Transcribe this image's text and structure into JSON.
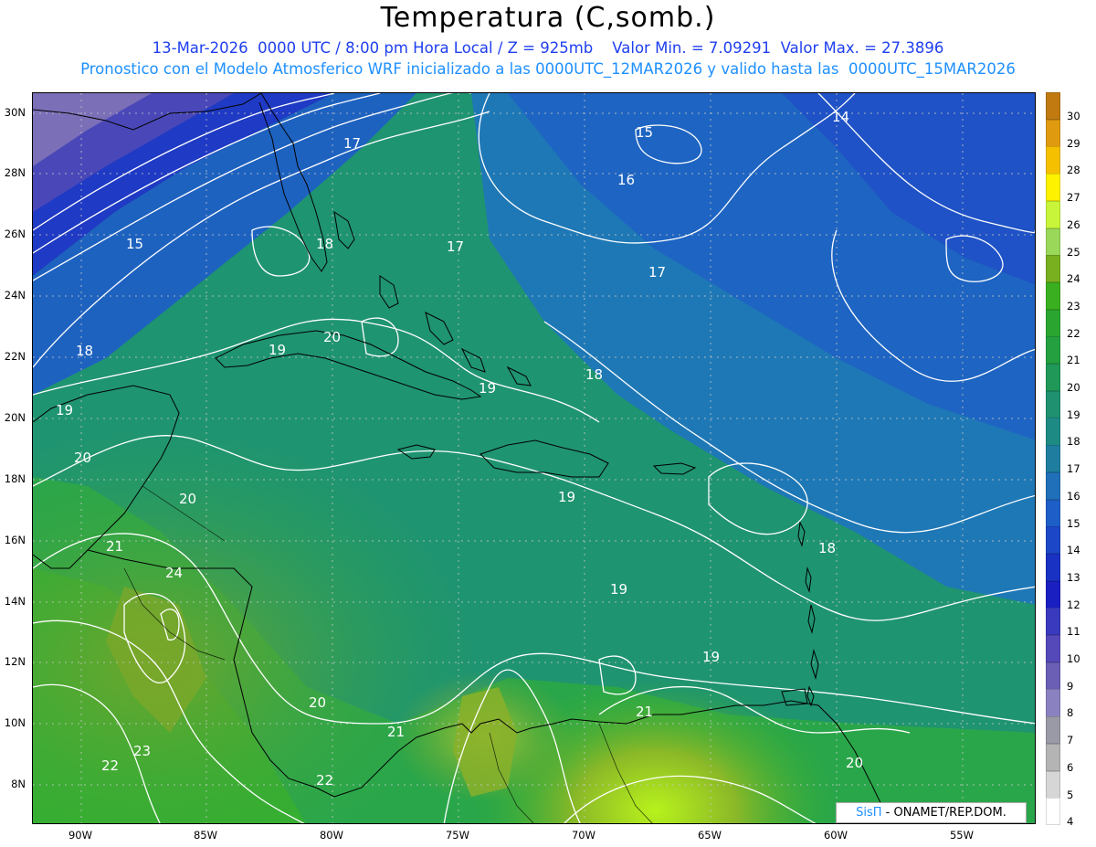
{
  "header": {
    "title": "Temperatura (C,somb.)",
    "subtitle_line1": "13-Mar-2026  0000 UTC / 8:00 pm Hora Local / Z = 925mb    Valor Min. = 7.09291  Valor Max. = 27.3896",
    "subtitle_line2": "Pronostico con el Modelo Atmosferico WRF inicializado a las 0000UTC_12MAR2026 y valido hasta las  0000UTC_15MAR2026"
  },
  "map": {
    "lat_labels": [
      "30N",
      "28N",
      "26N",
      "24N",
      "22N",
      "20N",
      "18N",
      "16N",
      "14N",
      "12N",
      "10N",
      "8N"
    ],
    "lon_labels": [
      "90W",
      "85W",
      "80W",
      "75W",
      "70W",
      "65W",
      "60W",
      "55W"
    ],
    "contour_labels": [
      "14",
      "15",
      "15",
      "16",
      "17",
      "17",
      "17",
      "18",
      "18",
      "18",
      "18",
      "19",
      "19",
      "19",
      "19",
      "19",
      "19",
      "20",
      "20",
      "20",
      "20",
      "20",
      "21",
      "21",
      "21",
      "22",
      "22",
      "23",
      "24"
    ],
    "colors": {
      "violet": "#7b6fb8",
      "deep_blue": "#1f2fc0",
      "blue": "#1e5ac8",
      "mid_blue": "#1f6fbb",
      "teal": "#1d8a8a",
      "teal_green": "#1f9470",
      "green": "#2aa64a",
      "bright_green": "#34b02c",
      "olive": "#7aa82a",
      "yellow_green": "#b8f21c",
      "land_outline": "#000000",
      "contour": "#ffffff"
    }
  },
  "colorbar": {
    "labels": [
      "30",
      "29",
      "28",
      "27",
      "26",
      "25",
      "24",
      "23",
      "22",
      "21",
      "20",
      "19",
      "18",
      "17",
      "16",
      "15",
      "14",
      "13",
      "12",
      "11",
      "10",
      "9",
      "8",
      "7",
      "6",
      "5",
      "4"
    ],
    "colors": [
      "#c07a10",
      "#e09a10",
      "#f5c000",
      "#fff200",
      "#c8f53a",
      "#9ad85a",
      "#78b020",
      "#3ab020",
      "#2aa630",
      "#24a040",
      "#1f9858",
      "#1f9070",
      "#1e8a84",
      "#1f7ea0",
      "#1f70b8",
      "#1e5ec8",
      "#1c48c8",
      "#1a32c4",
      "#1a1fc2",
      "#3a3abf",
      "#5548b8",
      "#6a5fb5",
      "#8a82c0",
      "#9a9aa6",
      "#b4b4b4",
      "#d6d6d6",
      "#ffffff"
    ]
  },
  "footer": {
    "brand": "SisΠ",
    "credit": " - ONAMET/REP.DOM."
  }
}
